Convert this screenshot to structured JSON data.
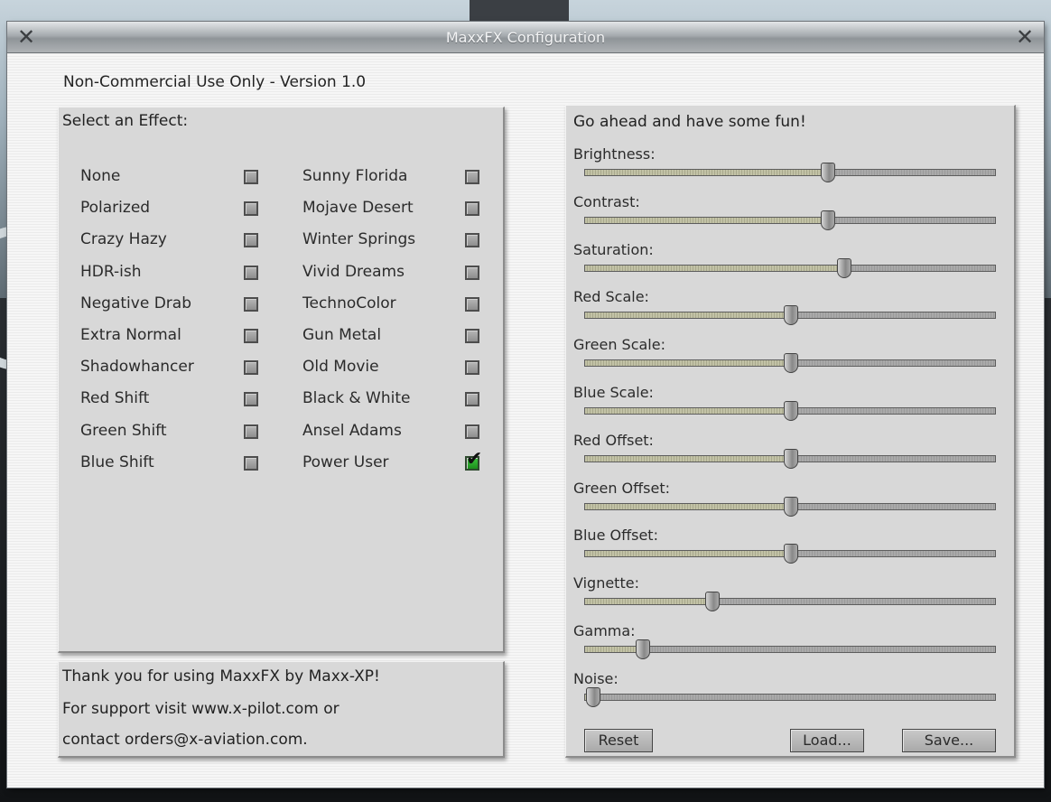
{
  "window": {
    "title": "MaxxFX Configuration"
  },
  "version_text": "Non-Commercial Use Only - Version 1.0",
  "effects": {
    "title": "Select an Effect:",
    "column1": [
      {
        "label": "None",
        "checked": false
      },
      {
        "label": "Polarized",
        "checked": false
      },
      {
        "label": "Crazy Hazy",
        "checked": false
      },
      {
        "label": "HDR-ish",
        "checked": false
      },
      {
        "label": "Negative Drab",
        "checked": false
      },
      {
        "label": "Extra Normal",
        "checked": false
      },
      {
        "label": "Shadowhancer",
        "checked": false
      },
      {
        "label": "Red Shift",
        "checked": false
      },
      {
        "label": "Green Shift",
        "checked": false
      },
      {
        "label": "Blue Shift",
        "checked": false
      }
    ],
    "column2": [
      {
        "label": "Sunny Florida",
        "checked": false
      },
      {
        "label": "Mojave Desert",
        "checked": false
      },
      {
        "label": "Winter Springs",
        "checked": false
      },
      {
        "label": "Vivid Dreams",
        "checked": false
      },
      {
        "label": "TechnoColor",
        "checked": false
      },
      {
        "label": "Gun Metal",
        "checked": false
      },
      {
        "label": "Old Movie",
        "checked": false
      },
      {
        "label": "Black & White",
        "checked": false
      },
      {
        "label": "Ansel Adams",
        "checked": false
      },
      {
        "label": "Power User",
        "checked": true
      }
    ]
  },
  "thanks": {
    "line1": "Thank you for using MaxxFX by Maxx-XP!",
    "line2": "For support visit www.x-pilot.com or",
    "line3": "contact orders@x-aviation.com."
  },
  "sliders": {
    "title": "Go ahead and have some fun!",
    "items": [
      {
        "label": "Brightness:",
        "value": 0.59
      },
      {
        "label": "Contrast:",
        "value": 0.59
      },
      {
        "label": "Saturation:",
        "value": 0.63
      },
      {
        "label": "Red Scale:",
        "value": 0.5
      },
      {
        "label": "Green Scale:",
        "value": 0.5
      },
      {
        "label": "Blue Scale:",
        "value": 0.5
      },
      {
        "label": "Red Offset:",
        "value": 0.5
      },
      {
        "label": "Green Offset:",
        "value": 0.5
      },
      {
        "label": "Blue Offset:",
        "value": 0.5
      },
      {
        "label": "Vignette:",
        "value": 0.31
      },
      {
        "label": "Gamma:",
        "value": 0.14
      },
      {
        "label": "Noise:",
        "value": 0.02
      }
    ],
    "buttons": {
      "reset": "Reset",
      "load": "Load...",
      "save": "Save..."
    }
  },
  "icons": {
    "close_left": "close-icon",
    "close_right": "close-icon",
    "checkmark": "check-icon"
  }
}
